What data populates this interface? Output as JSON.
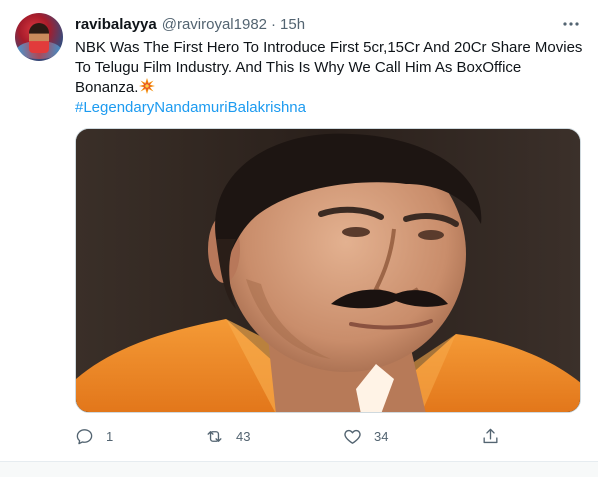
{
  "tweet": {
    "display_name": "ravibalayya",
    "handle": "@raviroyal1982",
    "separator": "·",
    "timestamp": "15h",
    "text": "NBK Was The First Hero To Introduce First 5cr,15Cr And 20Cr Share Movies To Telugu Film Industry. And This Is Why We Call Him As BoxOffice Bonanza.",
    "emoji_icon": "collision-emoji-icon",
    "hashtag": "#LegendaryNandamuriBalakrishna"
  },
  "actions": {
    "reply_count": "1",
    "retweet_count": "43",
    "like_count": "34"
  },
  "colors": {
    "link": "#1d9bf0",
    "secondary_text": "#536471",
    "primary_text": "#0f1419",
    "media_shirt": "#f08a24"
  },
  "icons": [
    "more-icon",
    "reply-icon",
    "retweet-icon",
    "like-icon",
    "share-icon"
  ]
}
